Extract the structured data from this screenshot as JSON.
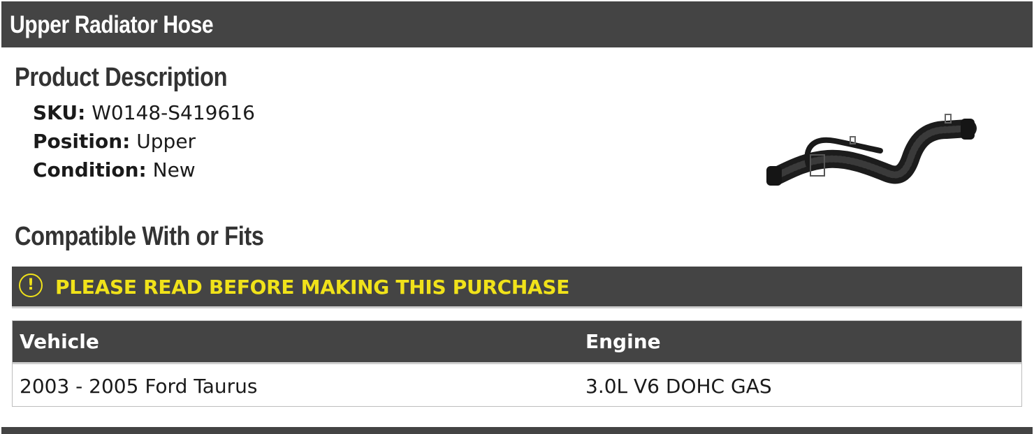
{
  "header": {
    "title": "Upper Radiator Hose"
  },
  "description": {
    "title": "Product Description",
    "rows": [
      {
        "label": "SKU:",
        "value": "W0148-S419616"
      },
      {
        "label": "Position:",
        "value": "Upper"
      },
      {
        "label": "Condition:",
        "value": "New"
      }
    ]
  },
  "compat": {
    "title": "Compatible With or Fits",
    "warning_icon": "exclamation-circle-icon",
    "warning": "PLEASE READ BEFORE MAKING THIS PURCHASE",
    "columns": [
      "Vehicle",
      "Engine"
    ],
    "rows": [
      {
        "vehicle": "2003 - 2005 Ford Taurus",
        "engine": "3.0L V6 DOHC GAS"
      }
    ]
  },
  "colors": {
    "header_bg": "#444444",
    "warning_text": "#f0e21a",
    "heading_text": "#333333"
  }
}
